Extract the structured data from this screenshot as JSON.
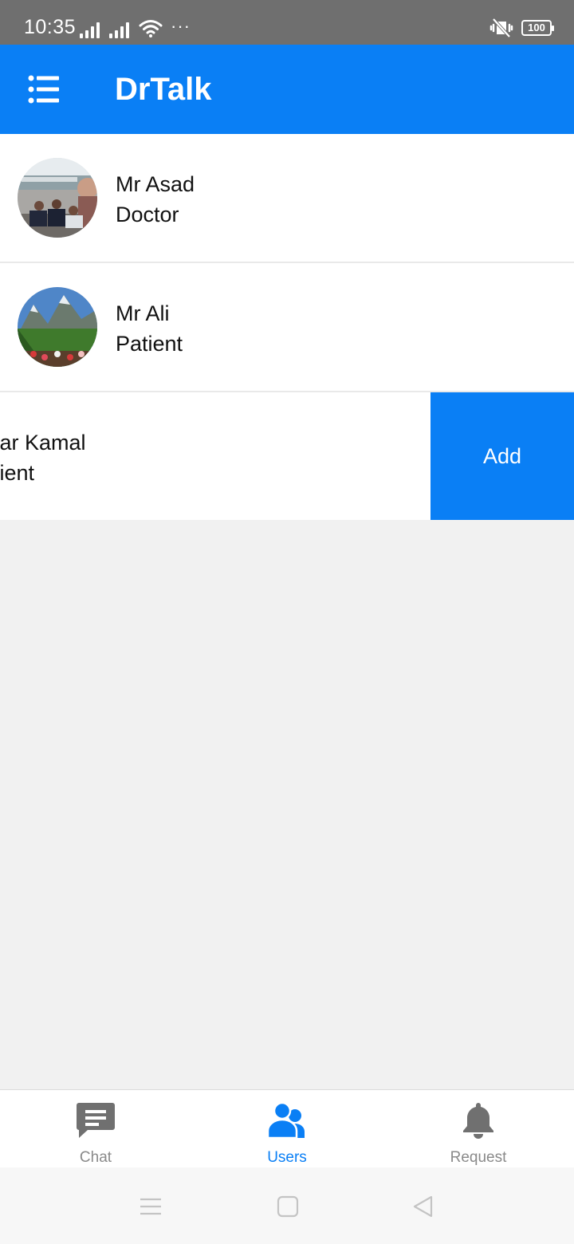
{
  "status_bar": {
    "time": "10:35",
    "dots": "···",
    "battery": "100"
  },
  "app_bar": {
    "title": "DrTalk",
    "menu_icon": "list-menu-icon",
    "color": "#0a7ff5"
  },
  "users": [
    {
      "name": "Mr Asad",
      "role": "Doctor",
      "avatar": "group-photo-avatar"
    },
    {
      "name": "Mr Ali",
      "role": "Patient",
      "avatar": "mountain-landscape-avatar"
    },
    {
      "name": "far Kamal",
      "role": "tient",
      "action_label": "Add"
    }
  ],
  "bottom_nav": {
    "items": [
      {
        "label": "Chat",
        "icon": "chat-bubble-icon",
        "active": false
      },
      {
        "label": "Users",
        "icon": "users-icon",
        "active": true
      },
      {
        "label": "Request",
        "icon": "bell-icon",
        "active": false
      }
    ],
    "active_color": "#0a7ff5",
    "inactive_color": "#8a8a8a"
  },
  "system_nav": {
    "buttons": [
      "menu-icon",
      "home-icon",
      "back-icon"
    ]
  }
}
